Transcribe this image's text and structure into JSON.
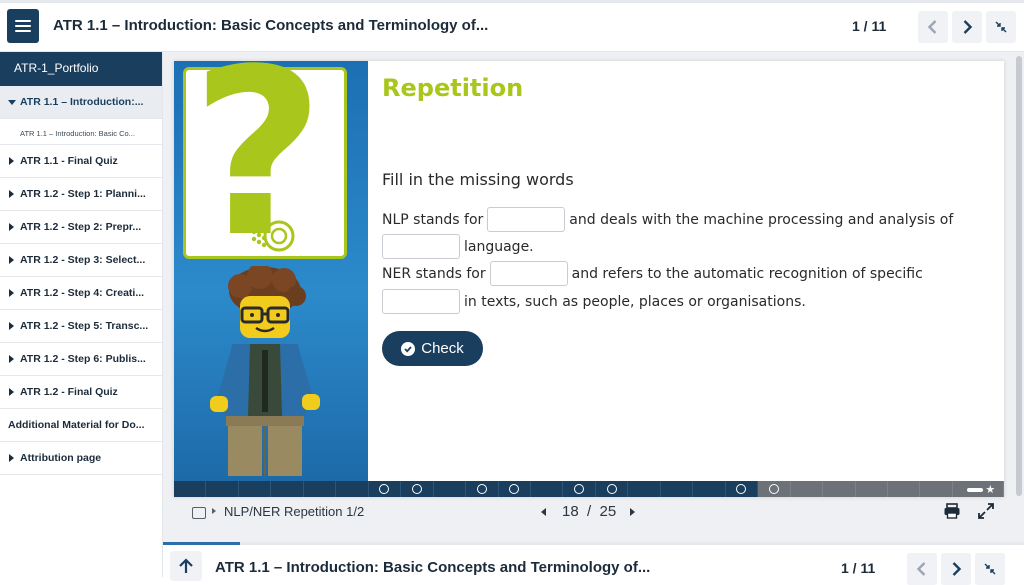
{
  "header": {
    "title": "ATR 1.1 – Introduction: Basic Concepts and Terminology of...",
    "pages": "1 / 11"
  },
  "sidebar": {
    "portfolio": "ATR-1_Portfolio",
    "items": [
      {
        "label": "ATR 1.1 – Introduction:..."
      },
      {
        "label": "ATR 1.1 – Introduction: Basic Co..."
      },
      {
        "label": "ATR 1.1 - Final Quiz"
      },
      {
        "label": "ATR 1.2 - Step 1: Planni..."
      },
      {
        "label": "ATR 1.2 - Step 2: Prepr..."
      },
      {
        "label": "ATR 1.2 - Step 3: Select..."
      },
      {
        "label": "ATR 1.2 - Step 4: Creati..."
      },
      {
        "label": "ATR 1.2 - Step 5: Transc..."
      },
      {
        "label": "ATR 1.2 - Step 6: Publis..."
      },
      {
        "label": "ATR 1.2 - Final Quiz"
      },
      {
        "label": "Additional Material for Do..."
      },
      {
        "label": "Attribution page"
      }
    ]
  },
  "slide": {
    "title": "Repetition",
    "instruction": "Fill in the missing words",
    "line1_a": "NLP stands for",
    "line1_b": "and deals with the machine processing and analysis of",
    "line2": "language.",
    "line3_a": "NER stands for",
    "line3_b": "and refers to the automatic recognition of specific",
    "line4": "in texts, such as people, places or organisations.",
    "check_label": "Check"
  },
  "progress": {
    "current": 18,
    "total": 25
  },
  "card_footer": {
    "title": "NLP/NER Repetition 1/2",
    "current_page": "18",
    "separator": "/",
    "total_pages": "25"
  },
  "bottom_bar": {
    "title": "ATR 1.1 – Introduction: Basic Concepts and Terminology of...",
    "pages": "1 / 11"
  },
  "colors": {
    "navy": "#1a3e5e",
    "accent_green": "#a8c61b",
    "hero_blue": "#2c8acb"
  }
}
